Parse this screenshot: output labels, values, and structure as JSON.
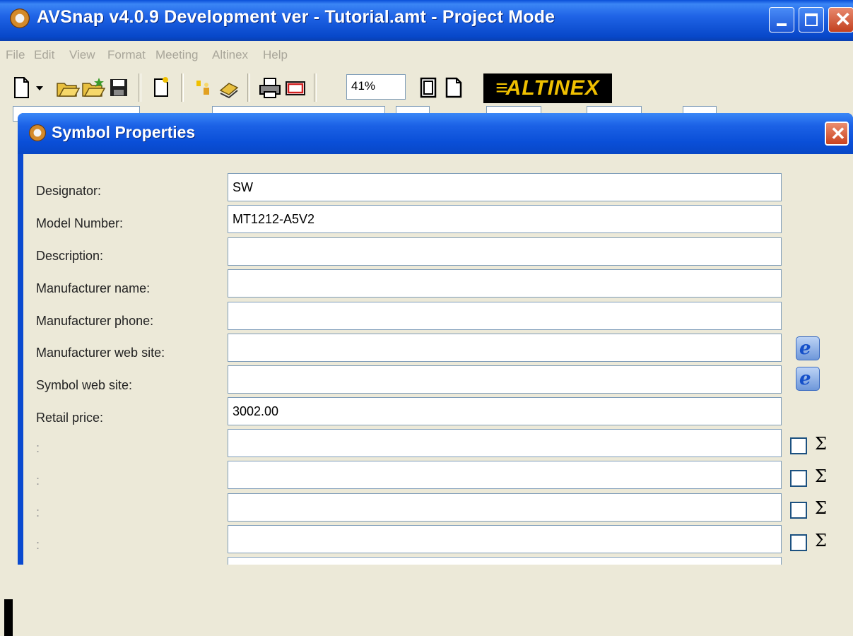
{
  "window": {
    "title": "AVSnap v4.0.9 Development ver - Tutorial.amt  - Project Mode"
  },
  "menu": [
    "File",
    "Edit",
    "View",
    "Format",
    "Meeting",
    "Altinex",
    "Help"
  ],
  "toolbar": {
    "zoom_value": "41%",
    "logo_text": "ALTINEX",
    "icons": [
      "new-document-icon",
      "dropdown-arrow-icon",
      "open-folder-icon",
      "open-project-icon",
      "save-icon",
      "page-icon",
      "wizard-icon",
      "library-icon",
      "print-icon",
      "print-preview-icon",
      "page-portrait-icon",
      "page-landscape-icon"
    ]
  },
  "dialog": {
    "title": "Symbol Properties",
    "fields": [
      {
        "label": "Designator:",
        "value": "SW"
      },
      {
        "label": "Model Number:",
        "value": "MT1212-A5V2"
      },
      {
        "label": "Description:",
        "value": ""
      },
      {
        "label": "Manufacturer name:",
        "value": ""
      },
      {
        "label": "Manufacturer phone:",
        "value": ""
      },
      {
        "label": "Manufacturer web site:",
        "value": ""
      },
      {
        "label": "Symbol web site:",
        "value": ""
      },
      {
        "label": "Retail price:",
        "value": "3002.00"
      },
      {
        "label": ":",
        "value": ""
      },
      {
        "label": ":",
        "value": ""
      },
      {
        "label": ":",
        "value": ""
      },
      {
        "label": ":",
        "value": ""
      }
    ],
    "sum_symbol": "Σ",
    "browse_icon": "internet-explorer-icon"
  },
  "colors": {
    "titlebar": "#0a4fd8",
    "window_bg": "#ece9d8",
    "close_button": "#c9411e",
    "logo_text": "#f0c000"
  }
}
